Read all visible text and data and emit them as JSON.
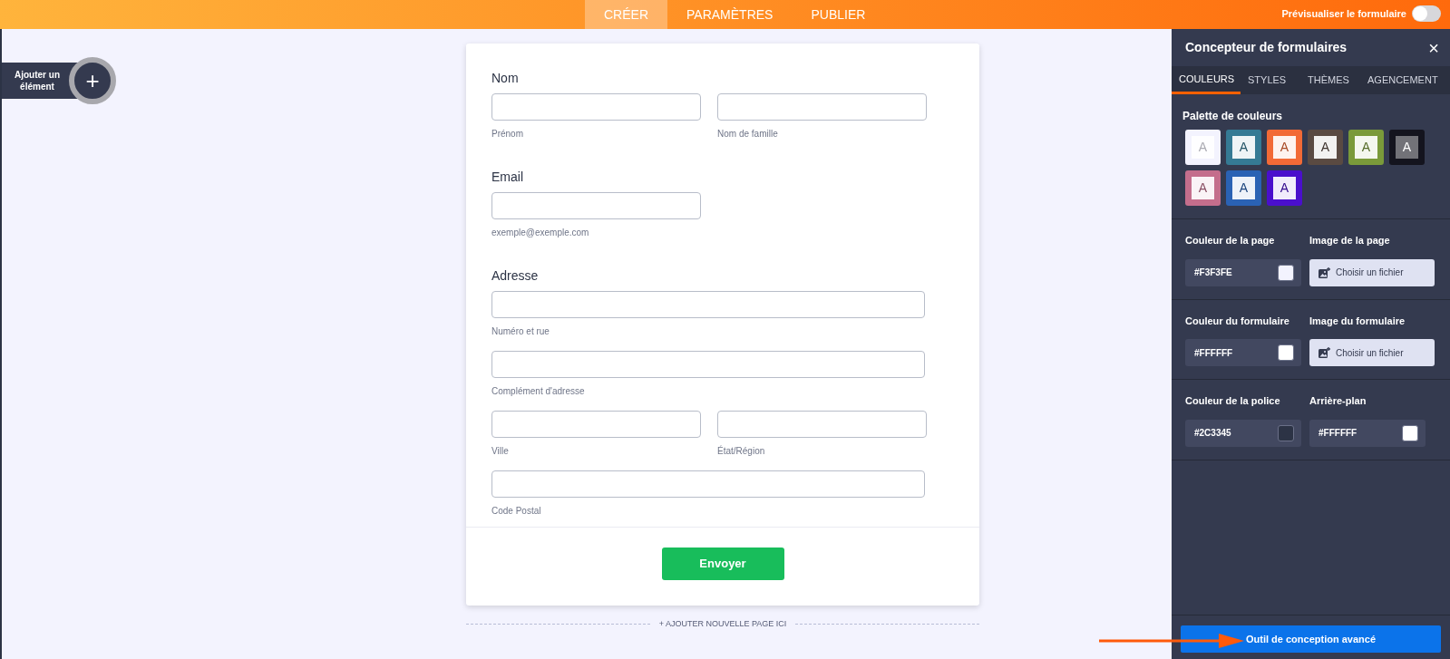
{
  "topbar": {
    "tabs": [
      {
        "label": "CRÉER",
        "selected": true
      },
      {
        "label": "PARAMÈTRES",
        "selected": false
      },
      {
        "label": "PUBLIER",
        "selected": false
      }
    ],
    "preview": {
      "label": "Prévisualiser le formulaire",
      "on": false
    }
  },
  "add_element": {
    "label": "Ajouter un élément",
    "icon": "+"
  },
  "form": {
    "fields": [
      {
        "label": "Nom",
        "rows": [
          [
            {
              "sublabel": "Prénom",
              "kind": "half"
            },
            {
              "sublabel": "Nom de famille",
              "kind": "half"
            }
          ]
        ]
      },
      {
        "label": "Email",
        "rows": [
          [
            {
              "sublabel": "exemple@exemple.com",
              "kind": "half"
            }
          ]
        ]
      },
      {
        "label": "Adresse",
        "rows": [
          [
            {
              "sublabel": "Numéro et rue",
              "kind": "full"
            }
          ],
          [
            {
              "sublabel": "Complément d'adresse",
              "kind": "full"
            }
          ],
          [
            {
              "sublabel": "Ville",
              "kind": "half"
            },
            {
              "sublabel": "État/Région",
              "kind": "half"
            }
          ],
          [
            {
              "sublabel": "Code Postal",
              "kind": "full"
            }
          ]
        ]
      }
    ],
    "submit": "Envoyer"
  },
  "add_page": "+ AJOUTER NOUVELLE PAGE ICI",
  "designer": {
    "title": "Concepteur de formulaires",
    "close": "×",
    "tabs": [
      {
        "label": "COULEURS",
        "selected": true
      },
      {
        "label": "STYLES",
        "selected": false
      },
      {
        "label": "THÈMES",
        "selected": false
      },
      {
        "label": "AGENCEMENT",
        "selected": false
      }
    ],
    "palette_title": "Palette de couleurs",
    "palette": [
      {
        "label": "A",
        "kind": "light",
        "color": "#f3f3fe"
      },
      {
        "label": "A",
        "kind": "light",
        "color": "#357a94"
      },
      {
        "label": "A",
        "kind": "light",
        "color": "#f26a36"
      },
      {
        "label": "A",
        "kind": "light",
        "color": "#5a4a42"
      },
      {
        "label": "A",
        "kind": "light",
        "color": "#7a9a3a"
      },
      {
        "label": "A",
        "kind": "dark",
        "color": "#14141e"
      },
      {
        "label": "A",
        "kind": "light",
        "color": "#c46e8c"
      },
      {
        "label": "A",
        "kind": "light",
        "color": "#2a62b4"
      },
      {
        "label": "A",
        "kind": "light",
        "color": "#4a0fcc"
      }
    ],
    "settings": [
      [
        {
          "kind": "color",
          "label": "Couleur de la page",
          "value": "#F3F3FE",
          "color": "#f3f3fe"
        },
        {
          "kind": "file",
          "label": "Image de la page",
          "button": "Choisir un fichier"
        }
      ],
      [
        {
          "kind": "color",
          "label": "Couleur du formulaire",
          "value": "#FFFFFF",
          "color": "#ffffff"
        },
        {
          "kind": "file",
          "label": "Image du formulaire",
          "button": "Choisir un fichier"
        }
      ],
      [
        {
          "kind": "color",
          "label": "Couleur de la police",
          "value": "#2C3345",
          "color": "#2c3345"
        },
        {
          "kind": "color",
          "label": "Arrière-plan",
          "value": "#FFFFFF",
          "color": "#ffffff"
        }
      ]
    ],
    "advanced_button": "Outil de conception avancé"
  }
}
